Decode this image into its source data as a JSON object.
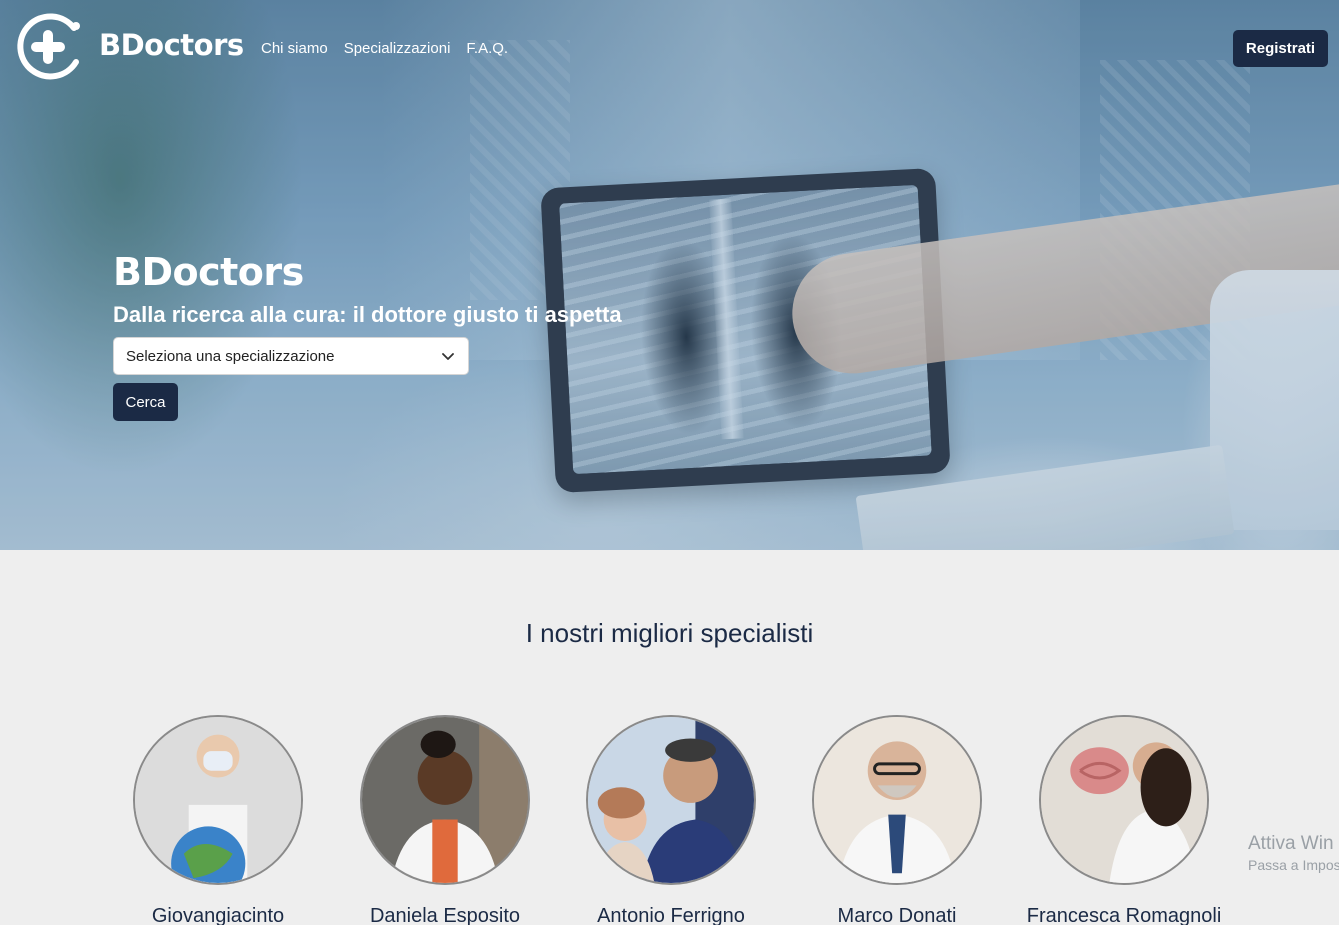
{
  "nav": {
    "brand": "BDoctors",
    "links": [
      "Chi siamo",
      "Specializzazioni",
      "F.A.Q."
    ],
    "register_label": "Registrati"
  },
  "hero": {
    "title": "BDoctors",
    "subtitle": "Dalla ricerca alla cura: il dottore giusto ti aspetta",
    "select_value": "Seleziona una specializzazione",
    "search_label": "Cerca"
  },
  "specialists": {
    "title": "I nostri migliori specialisti",
    "doctors": [
      {
        "name": "Giovangiacinto"
      },
      {
        "name": "Daniela Esposito"
      },
      {
        "name": "Antonio Ferrigno"
      },
      {
        "name": "Marco Donati"
      },
      {
        "name": "Francesca Romagnoli"
      }
    ]
  },
  "watermark": {
    "line1": "Attiva Win",
    "line2": "Passa a Impos"
  },
  "colors": {
    "primary": "#1b2a45",
    "background": "#eeeeee"
  }
}
